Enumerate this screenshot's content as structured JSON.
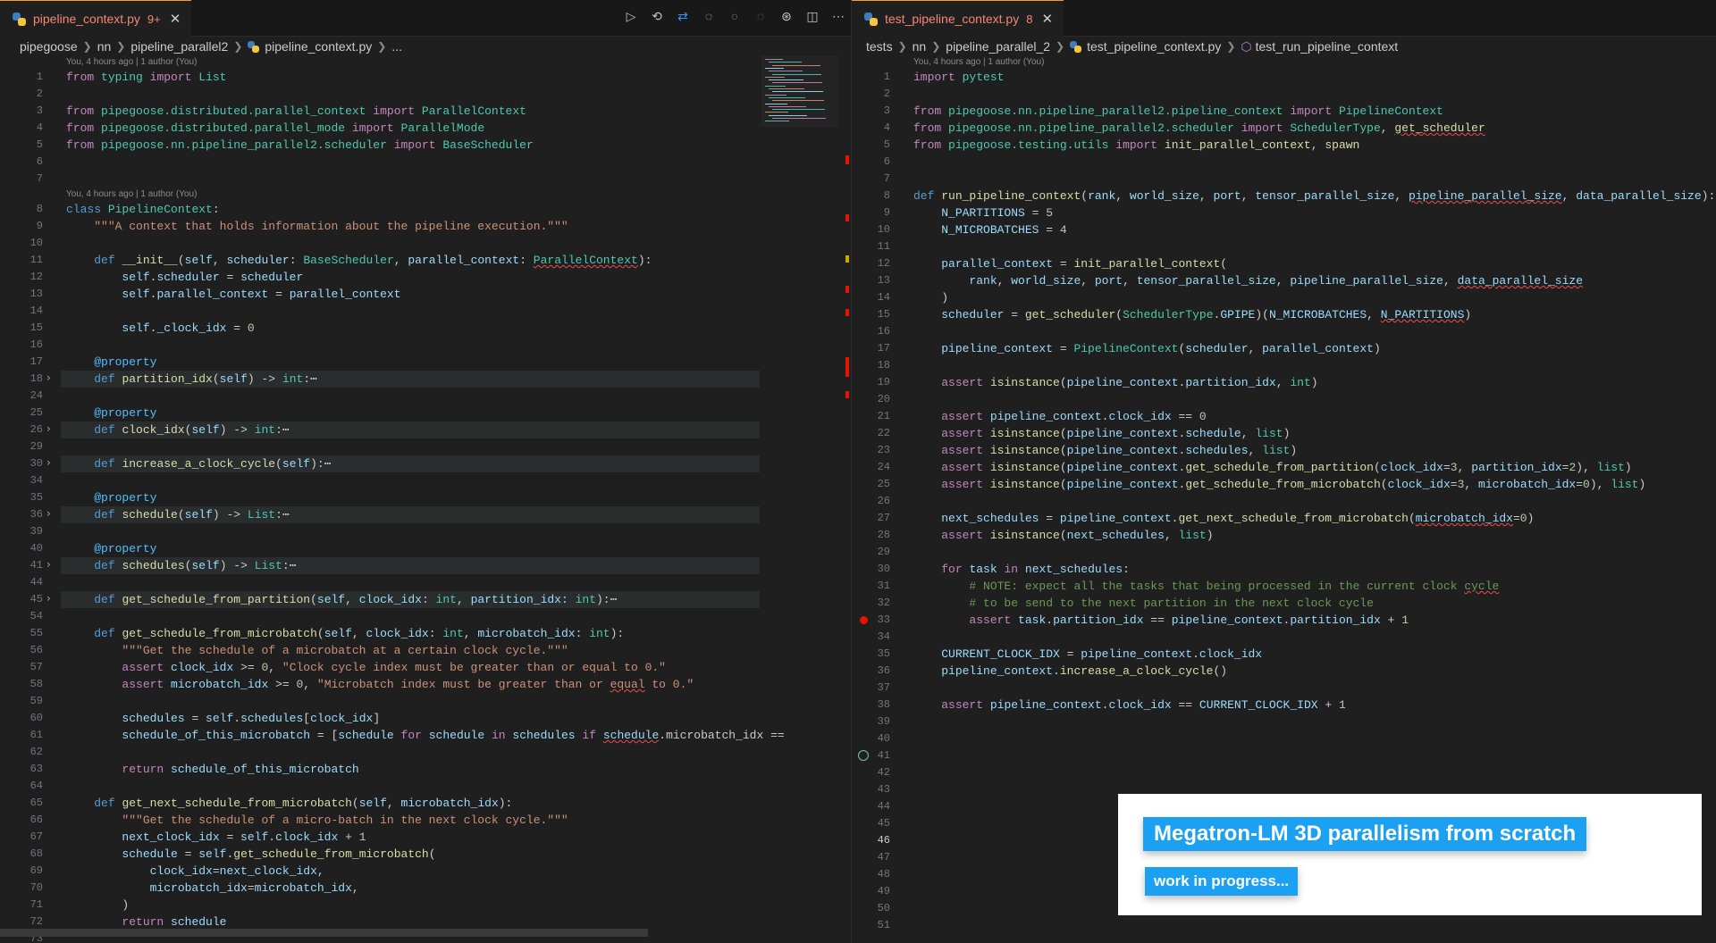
{
  "left": {
    "tab": {
      "name": "pipeline_context.py",
      "problems": "9+",
      "close": "✕"
    },
    "actions": [
      "run-icon",
      "history-icon",
      "compare-icon",
      "go-back-icon",
      "circle-dot-icon",
      "go-forward-icon",
      "merge-icon",
      "split-editor-icon",
      "more-icon"
    ],
    "breadcrumb": [
      "pipegoose",
      "nn",
      "pipeline_parallel2",
      "pipeline_context.py",
      "..."
    ],
    "lens": [
      {
        "line": 1,
        "text": "You, 4 hours ago | 1 author (You)"
      },
      {
        "line": 8,
        "text": "You, 4 hours ago | 1 author (You)"
      }
    ],
    "lines": [
      {
        "n": "1",
        "html": "<span class='k'>from</span> <span class='c'>typing</span> <span class='k'>import</span> <span class='c'>List</span>"
      },
      {
        "n": "2",
        "html": ""
      },
      {
        "n": "3",
        "html": "<span class='k'>from</span> <span class='c'>pipegoose.distributed.parallel_context</span> <span class='k'>import</span> <span class='c'>ParallelContext</span>"
      },
      {
        "n": "4",
        "html": "<span class='k'>from</span> <span class='c'>pipegoose.distributed.parallel_mode</span> <span class='k'>import</span> <span class='c'>ParallelMode</span>"
      },
      {
        "n": "5",
        "html": "<span class='k'>from</span> <span class='c'>pipegoose.nn.pipeline_parallel2.scheduler</span> <span class='k'>import</span> <span class='c'>BaseScheduler</span>"
      },
      {
        "n": "6",
        "html": ""
      },
      {
        "n": "7",
        "html": ""
      },
      {
        "n": "8",
        "html": "<span class='kf'>class</span> <span class='c'>PipelineContext</span>:"
      },
      {
        "n": "9",
        "html": "    <span class='s'>\"\"\"A context that holds information about the pipeline execution.\"\"\"</span>"
      },
      {
        "n": "10",
        "html": ""
      },
      {
        "n": "11",
        "html": "    <span class='kf'>def</span> <span class='f'>__init__</span>(<span class='v'>self</span>, <span class='v'>scheduler</span>: <span class='c'>BaseScheduler</span>, <span class='v'>parallel_context</span>: <span class='c sq'>ParallelContext</span>):"
      },
      {
        "n": "12",
        "html": "        <span class='v'>self</span>.<span class='v'>scheduler</span> = <span class='v'>scheduler</span>"
      },
      {
        "n": "13",
        "html": "        <span class='v'>self</span>.<span class='v'>parallel_context</span> = <span class='v'>parallel_context</span>"
      },
      {
        "n": "14",
        "html": ""
      },
      {
        "n": "15",
        "html": "        <span class='v'>self</span>.<span class='v'>_clock_idx</span> = <span class='n'>0</span>"
      },
      {
        "n": "16",
        "html": ""
      },
      {
        "n": "17",
        "html": "    <span class='dec'>@property</span>"
      },
      {
        "n": "18",
        "html": "    <span class='kf'>def</span> <span class='f'>partition_idx</span>(<span class='v'>self</span>) -> <span class='c'>int</span>:<span class='p'>⋯</span>",
        "fold": true
      },
      {
        "n": "24",
        "html": ""
      },
      {
        "n": "25",
        "html": "    <span class='dec'>@property</span>"
      },
      {
        "n": "26",
        "html": "    <span class='kf'>def</span> <span class='f'>clock_idx</span>(<span class='v'>self</span>) -> <span class='c'>int</span>:<span class='p'>⋯</span>",
        "fold": true
      },
      {
        "n": "29",
        "html": ""
      },
      {
        "n": "30",
        "html": "    <span class='kf'>def</span> <span class='f'>increase_a_clock_cycle</span>(<span class='v'>self</span>):<span class='p'>⋯</span>",
        "fold": true
      },
      {
        "n": "34",
        "html": ""
      },
      {
        "n": "35",
        "html": "    <span class='dec'>@property</span>"
      },
      {
        "n": "36",
        "html": "    <span class='kf'>def</span> <span class='f'>schedule</span>(<span class='v'>self</span>) -> <span class='c'>List</span>:<span class='p'>⋯</span>",
        "fold": true
      },
      {
        "n": "39",
        "html": ""
      },
      {
        "n": "40",
        "html": "    <span class='dec'>@property</span>"
      },
      {
        "n": "41",
        "html": "    <span class='kf'>def</span> <span class='f'>schedules</span>(<span class='v'>self</span>) -> <span class='c'>List</span>:<span class='p'>⋯</span>",
        "fold": true
      },
      {
        "n": "44",
        "html": ""
      },
      {
        "n": "45",
        "html": "    <span class='kf'>def</span> <span class='f'>get_schedule_from_partition</span>(<span class='v'>self</span>, <span class='v'>clock_idx</span>: <span class='c'>int</span>, <span class='v'>partition_idx</span>: <span class='c'>int</span>):<span class='p'>⋯</span>",
        "fold": true
      },
      {
        "n": "54",
        "html": ""
      },
      {
        "n": "55",
        "html": "    <span class='kf'>def</span> <span class='f'>get_schedule_from_microbatch</span>(<span class='v'>self</span>, <span class='v'>clock_idx</span>: <span class='c'>int</span>, <span class='v'>microbatch_idx</span>: <span class='c'>int</span>):"
      },
      {
        "n": "56",
        "html": "        <span class='s'>\"\"\"Get the schedule of a microbatch at a certain clock cycle.\"\"\"</span>"
      },
      {
        "n": "57",
        "html": "        <span class='k'>assert</span> <span class='v'>clock_idx</span> >= <span class='n'>0</span>, <span class='s'>\"Clock cycle index must be greater than or equal to 0.\"</span>"
      },
      {
        "n": "58",
        "html": "        <span class='k'>assert</span> <span class='v'>microbatch_idx</span> >= <span class='n'>0</span>, <span class='s'>\"Microbatch index must be greater than or <span class='sq'>equal</span> to 0.\"</span>"
      },
      {
        "n": "59",
        "html": ""
      },
      {
        "n": "60",
        "html": "        <span class='v'>schedules</span> = <span class='v'>self</span>.<span class='v'>schedules</span>[<span class='v'>clock_idx</span>]"
      },
      {
        "n": "61",
        "html": "        <span class='v'>schedule_of_this_microbatch</span> = [<span class='v'>schedule</span> <span class='k'>for</span> <span class='v'>schedule</span> <span class='k'>in</span> <span class='v'>schedules</span> <span class='k'>if</span> <span class='v sq'>schedule</span>.microbatch_idx =="
      },
      {
        "n": "62",
        "html": ""
      },
      {
        "n": "63",
        "html": "        <span class='k'>return</span> <span class='v'>schedule_of_this_microbatch</span>"
      },
      {
        "n": "64",
        "html": ""
      },
      {
        "n": "65",
        "html": "    <span class='kf'>def</span> <span class='f'>get_next_schedule_from_microbatch</span>(<span class='v'>self</span>, <span class='v'>microbatch_idx</span>):"
      },
      {
        "n": "66",
        "html": "        <span class='s'>\"\"\"Get the schedule of a micro-batch in the next clock cycle.\"\"\"</span>"
      },
      {
        "n": "67",
        "html": "        <span class='v'>next_clock_idx</span> = <span class='v'>self</span>.<span class='v'>clock_idx</span> + <span class='n'>1</span>"
      },
      {
        "n": "68",
        "html": "        <span class='v'>schedule</span> = <span class='v'>self</span>.<span class='f'>get_schedule_from_microbatch</span>("
      },
      {
        "n": "69",
        "html": "            <span class='v'>clock_idx</span>=<span class='v'>next_clock_idx</span>,"
      },
      {
        "n": "70",
        "html": "            <span class='v'>microbatch_idx</span>=<span class='v'>microbatch_idx</span>,"
      },
      {
        "n": "71",
        "html": "        )"
      },
      {
        "n": "72",
        "html": "        <span class='k'>return</span> <span class='v'>schedule</span>"
      },
      {
        "n": "73",
        "html": ""
      }
    ]
  },
  "right": {
    "tab": {
      "name": "test_pipeline_context.py",
      "problems": "8",
      "close": "✕"
    },
    "breadcrumb": [
      "tests",
      "nn",
      "pipeline_parallel_2",
      "test_pipeline_context.py",
      "test_run_pipeline_context"
    ],
    "lens": [
      {
        "line": 1,
        "text": "You, 4 hours ago | 1 author (You)"
      }
    ],
    "lines": [
      {
        "n": "1",
        "html": "<span class='k'>import</span> <span class='c'>pytest</span>"
      },
      {
        "n": "2",
        "html": ""
      },
      {
        "n": "3",
        "html": "<span class='k'>from</span> <span class='c'>pipegoose.nn.pipeline_parallel2.pipeline_context</span> <span class='k'>import</span> <span class='c'>PipelineContext</span>"
      },
      {
        "n": "4",
        "html": "<span class='k'>from</span> <span class='c'>pipegoose.nn.pipeline_parallel2.scheduler</span> <span class='k'>import</span> <span class='c'>SchedulerType</span>, <span class='f sq'>get_scheduler</span>"
      },
      {
        "n": "5",
        "html": "<span class='k'>from</span> <span class='c'>pipegoose.testing.utils</span> <span class='k'>import</span> <span class='f'>init_parallel_context</span>, <span class='f'>spawn</span>"
      },
      {
        "n": "6",
        "html": ""
      },
      {
        "n": "7",
        "html": ""
      },
      {
        "n": "8",
        "html": "<span class='kf'>def</span> <span class='f'>run_pipeline_context</span>(<span class='v'>rank</span>, <span class='v'>world_size</span>, <span class='v'>port</span>, <span class='v'>tensor_parallel_size</span>, <span class='v sq'>pipeline_parallel_size</span>, <span class='v'>data_parallel_size</span>):"
      },
      {
        "n": "9",
        "html": "    <span class='v'>N_PARTITIONS</span> = <span class='n'>5</span>"
      },
      {
        "n": "10",
        "html": "    <span class='v'>N_MICROBATCHES</span> = <span class='n'>4</span>"
      },
      {
        "n": "11",
        "html": ""
      },
      {
        "n": "12",
        "html": "    <span class='v'>parallel_context</span> = <span class='f'>init_parallel_context</span>("
      },
      {
        "n": "13",
        "html": "        <span class='v'>rank</span>, <span class='v'>world_size</span>, <span class='v'>port</span>, <span class='v'>tensor_parallel_size</span>, <span class='v'>pipeline_parallel_size</span>, <span class='v sq'>data_parallel_size</span>"
      },
      {
        "n": "14",
        "html": "    )"
      },
      {
        "n": "15",
        "html": "    <span class='v'>scheduler</span> = <span class='f'>get_scheduler</span>(<span class='c'>SchedulerType</span>.<span class='v'>GPIPE</span>)(<span class='v'>N_MICROBATCHES</span>, <span class='v sq'>N_PARTITIONS</span>)"
      },
      {
        "n": "16",
        "html": ""
      },
      {
        "n": "17",
        "html": "    <span class='v'>pipeline_context</span> = <span class='c'>PipelineContext</span>(<span class='v'>scheduler</span>, <span class='v'>parallel_context</span>)"
      },
      {
        "n": "18",
        "html": ""
      },
      {
        "n": "19",
        "html": "    <span class='k'>assert</span> <span class='f'>isinstance</span>(<span class='v'>pipeline_context</span>.<span class='v'>partition_idx</span>, <span class='c'>int</span>)"
      },
      {
        "n": "20",
        "html": ""
      },
      {
        "n": "21",
        "html": "    <span class='k'>assert</span> <span class='v'>pipeline_context</span>.<span class='v'>clock_idx</span> == <span class='n'>0</span>"
      },
      {
        "n": "22",
        "html": "    <span class='k'>assert</span> <span class='f'>isinstance</span>(<span class='v'>pipeline_context</span>.<span class='v'>schedule</span>, <span class='c'>list</span>)"
      },
      {
        "n": "23",
        "html": "    <span class='k'>assert</span> <span class='f'>isinstance</span>(<span class='v'>pipeline_context</span>.<span class='v'>schedules</span>, <span class='c'>list</span>)"
      },
      {
        "n": "24",
        "html": "    <span class='k'>assert</span> <span class='f'>isinstance</span>(<span class='v'>pipeline_context</span>.<span class='f'>get_schedule_from_partition</span>(<span class='v'>clock_idx</span>=<span class='n'>3</span>, <span class='v'>partition_idx</span>=<span class='n'>2</span>), <span class='c'>list</span>)"
      },
      {
        "n": "25",
        "html": "    <span class='k'>assert</span> <span class='f'>isinstance</span>(<span class='v'>pipeline_context</span>.<span class='f'>get_schedule_from_microbatch</span>(<span class='v'>clock_idx</span>=<span class='n'>3</span>, <span class='v'>microbatch_idx</span>=<span class='n'>0</span>), <span class='c'>list</span>)"
      },
      {
        "n": "26",
        "html": ""
      },
      {
        "n": "27",
        "html": "    <span class='v'>next_schedules</span> = <span class='v'>pipeline_context</span>.<span class='f'>get_next_schedule_from_microbatch</span>(<span class='v sq'>microbatch_idx</span>=<span class='n'>0</span>)"
      },
      {
        "n": "28",
        "html": "    <span class='k'>assert</span> <span class='f'>isinstance</span>(<span class='v'>next_schedules</span>, <span class='c'>list</span>)"
      },
      {
        "n": "29",
        "html": ""
      },
      {
        "n": "30",
        "html": "    <span class='k'>for</span> <span class='v'>task</span> <span class='k'>in</span> <span class='v'>next_schedules</span>:"
      },
      {
        "n": "31",
        "html": "        <span class='d'># NOTE: expect all the tasks that being processed in the current clock <span class='sq'>cycle</span></span>"
      },
      {
        "n": "32",
        "html": "        <span class='d'># to be send to the next partition in the next clock cycle</span>"
      },
      {
        "n": "33",
        "html": "        <span class='k'>assert</span> <span class='v'>task</span>.<span class='v'>partition_idx</span> == <span class='v'>pipeline_context</span>.<span class='v'>partition_idx</span> + <span class='n'>1</span>",
        "bp": true
      },
      {
        "n": "34",
        "html": ""
      },
      {
        "n": "35",
        "html": "    <span class='v'>CURRENT_CLOCK_IDX</span> = <span class='v'>pipeline_context</span>.<span class='v'>clock_idx</span>"
      },
      {
        "n": "36",
        "html": "    <span class='v'>pipeline_context</span>.<span class='f'>increase_a_clock_cycle</span>()"
      },
      {
        "n": "37",
        "html": ""
      },
      {
        "n": "38",
        "html": "    <span class='k'>assert</span> <span class='v'>pipeline_context</span>.<span class='v'>clock_idx</span> == <span class='v'>CURRENT_CLOCK_IDX</span> + <span class='n'>1</span>"
      },
      {
        "n": "39",
        "html": ""
      },
      {
        "n": "40",
        "html": ""
      },
      {
        "n": "41",
        "html": "",
        "tick": true
      },
      {
        "n": "42",
        "html": ""
      },
      {
        "n": "43",
        "html": ""
      },
      {
        "n": "44",
        "html": ""
      },
      {
        "n": "45",
        "html": ""
      },
      {
        "n": "46",
        "html": "",
        "active": true
      },
      {
        "n": "47",
        "html": ""
      },
      {
        "n": "48",
        "html": ""
      },
      {
        "n": "49",
        "html": ""
      },
      {
        "n": "50",
        "html": ""
      },
      {
        "n": "51",
        "html": ""
      }
    ]
  },
  "overlay": {
    "title": "Megatron-LM 3D parallelism from scratch",
    "subtitle": "work in progress..."
  },
  "colors": {
    "accent": "#1ba0f2",
    "error": "#f48771",
    "breakpoint": "#e51400"
  }
}
